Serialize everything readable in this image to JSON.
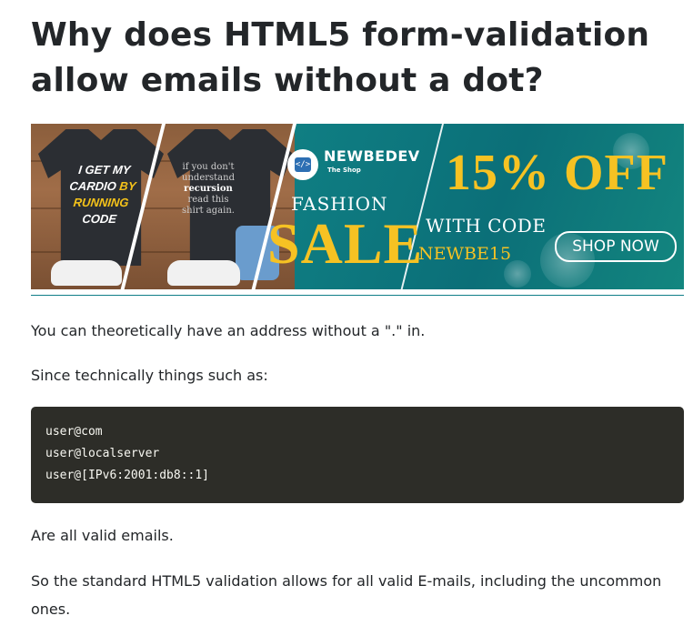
{
  "question": {
    "title": "Why does HTML5 form-validation allow emails without a dot?"
  },
  "ad": {
    "shirt1": {
      "line1": "I GET MY",
      "line2a": "CARDIO ",
      "line2b": "BY",
      "line3": "RUNNING",
      "line4": "CODE"
    },
    "shirt2": {
      "line1": "if you don't",
      "line2": "understand",
      "line3": "recursion",
      "line4": "read this",
      "line5": "shirt again."
    },
    "brand": "NEWBEDEV",
    "brand_sub": "The Shop",
    "logo_glyph": "</>",
    "fashion": "FASHION",
    "sale": "SALE",
    "discount": "15% OFF",
    "with_code": "WITH CODE",
    "code": "NEWBE15",
    "shop_now": "SHOP NOW",
    "colors": {
      "teal": "#0f7d82",
      "yellow": "#f6c223",
      "shirt": "#2b2e33"
    }
  },
  "answer": {
    "p1": "You can theoretically have an address without a \".\" in.",
    "p2": "Since technically things such as:",
    "code_lines": [
      "user@com",
      "user@localserver",
      "user@[IPv6:2001:db8::1]"
    ],
    "p3": "Are all valid emails.",
    "p4": "So the standard HTML5 validation allows for all valid E-mails, including the uncommon ones."
  }
}
